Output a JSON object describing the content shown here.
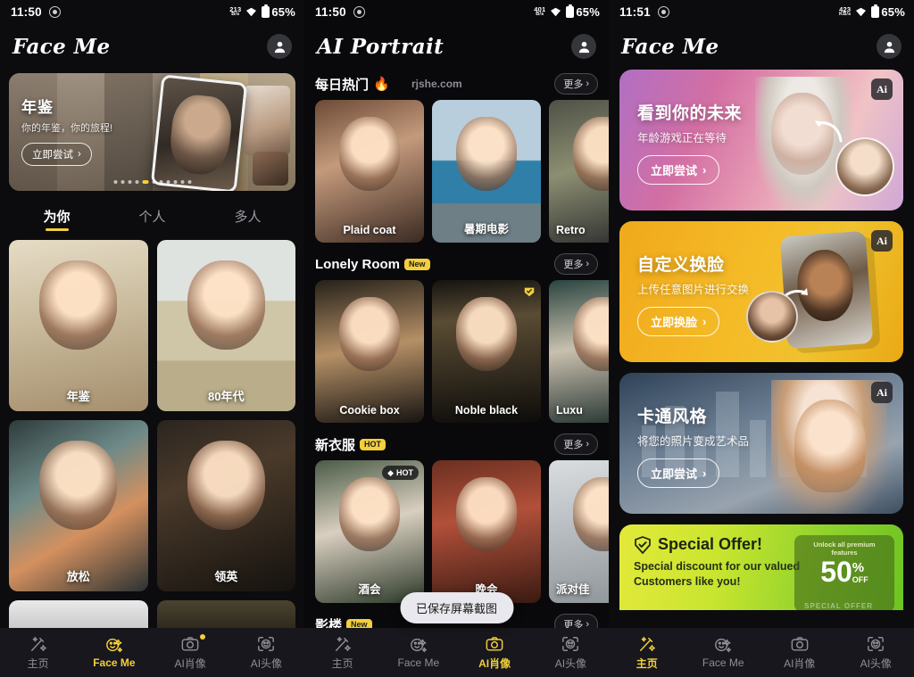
{
  "panels": [
    {
      "id": "left",
      "status": {
        "time": "11:50",
        "net_speed": "213",
        "net_unit": "B/s",
        "battery": "65%"
      },
      "header": {
        "brand": "Face Me",
        "avatar": "person-icon"
      },
      "hero": {
        "title": "年鉴",
        "subtitle": "你的年鉴，你的旅程!",
        "cta": "立即尝试",
        "dots_total": 12,
        "dots_active": 5
      },
      "tabs": [
        {
          "label": "为你",
          "active": true
        },
        {
          "label": "个人",
          "active": false
        },
        {
          "label": "多人",
          "active": false
        }
      ],
      "grid": [
        {
          "label": "年鉴",
          "style": "p-nianjian"
        },
        {
          "label": "80年代",
          "style": "p-80s"
        },
        {
          "label": "放松",
          "style": "p-relax"
        },
        {
          "label": "领英",
          "style": "p-linked"
        },
        {
          "label": "",
          "style": "p-bw"
        },
        {
          "label": "",
          "style": "p-dark"
        }
      ],
      "nav": [
        {
          "label": "主页",
          "icon": "magic-wand-icon",
          "active": false,
          "badge": false
        },
        {
          "label": "Face Me",
          "icon": "face-swap-icon",
          "active": true,
          "badge": false
        },
        {
          "label": "AI肖像",
          "icon": "camera-icon",
          "active": false,
          "badge": true
        },
        {
          "label": "AI头像",
          "icon": "face-scan-icon",
          "active": false,
          "badge": false
        }
      ]
    },
    {
      "id": "middle",
      "status": {
        "time": "11:50",
        "net_speed": "401",
        "net_unit": "B/s",
        "battery": "65%"
      },
      "header": {
        "brand": "AI Portrait",
        "avatar": "person-icon"
      },
      "watermark": "rjshe.com",
      "sections": [
        {
          "title": "每日热门",
          "emoji": "🔥",
          "badge": null,
          "more": "更多",
          "cards": [
            {
              "label": "Plaid coat",
              "style": "p-plaid",
              "tag": null
            },
            {
              "label": "暑期电影",
              "style": "p-summer",
              "tag": null
            },
            {
              "label": "Retro",
              "style": "p-retro",
              "tag": null
            }
          ]
        },
        {
          "title": "Lonely Room",
          "emoji": "",
          "badge": "New",
          "more": "更多",
          "cards": [
            {
              "label": "Cookie box",
              "style": "p-cookie",
              "tag": null
            },
            {
              "label": "Noble black",
              "style": "p-noble",
              "tag": "check"
            },
            {
              "label": "Luxu",
              "style": "p-luxu",
              "tag": null
            }
          ]
        },
        {
          "title": "新衣服",
          "emoji": "",
          "badge": "HOT",
          "more": "更多",
          "cards": [
            {
              "label": "酒会",
              "style": "p-party1",
              "tag": "HOT"
            },
            {
              "label": "晚会",
              "style": "p-party2",
              "tag": null
            },
            {
              "label": "派对佳",
              "style": "p-party3",
              "tag": null
            }
          ]
        },
        {
          "title": "影楼",
          "emoji": "",
          "badge": "New",
          "more": "更多",
          "cards": [
            {
              "label": "",
              "style": "p-studio1",
              "tag": null
            },
            {
              "label": "",
              "style": "p-studio2",
              "tag": null
            },
            {
              "label": "",
              "style": "p-studio3",
              "tag": null
            }
          ]
        }
      ],
      "toast": "已保存屏幕截图",
      "nav": [
        {
          "label": "主页",
          "icon": "magic-wand-icon",
          "active": false,
          "badge": false
        },
        {
          "label": "Face Me",
          "icon": "face-swap-icon",
          "active": false,
          "badge": false
        },
        {
          "label": "AI肖像",
          "icon": "camera-icon",
          "active": true,
          "badge": false
        },
        {
          "label": "AI头像",
          "icon": "face-scan-icon",
          "active": false,
          "badge": false
        }
      ]
    },
    {
      "id": "right",
      "status": {
        "time": "11:51",
        "net_speed": "423",
        "net_unit": "KB/s",
        "battery": "65%"
      },
      "header": {
        "brand": "Face Me",
        "avatar": "person-icon"
      },
      "banners": [
        {
          "title": "看到你的未来",
          "subtitle": "年龄游戏正在等待",
          "cta": "立即尝试",
          "chip": "Ai",
          "style": "b-future",
          "art": "future"
        },
        {
          "title": "自定义换脸",
          "subtitle": "上传任意图片进行交换",
          "cta": "立即换脸",
          "chip": "Ai",
          "style": "b-swap",
          "art": "swap"
        },
        {
          "title": "卡通风格",
          "subtitle": "将您的照片变成艺术品",
          "cta": "立即尝试",
          "chip": "Ai",
          "style": "b-cartoon",
          "art": "cartoon"
        }
      ],
      "offer": {
        "title": "Special Offer!",
        "subtitle": "Special discount for our valued\nCustomers like you!",
        "unlock": "Unlock all premium features",
        "number": "50",
        "percent": "%",
        "off": "OFF",
        "faint": "SPECIAL OFFER"
      },
      "nav": [
        {
          "label": "主页",
          "icon": "magic-wand-icon",
          "active": true,
          "badge": false
        },
        {
          "label": "Face Me",
          "icon": "face-swap-icon",
          "active": false,
          "badge": false
        },
        {
          "label": "AI肖像",
          "icon": "camera-icon",
          "active": false,
          "badge": false
        },
        {
          "label": "AI头像",
          "icon": "face-scan-icon",
          "active": false,
          "badge": false
        }
      ]
    }
  ],
  "colors": {
    "accent": "#f3cf3c",
    "background": "#0c0c0f",
    "nav_background": "#17171d"
  }
}
